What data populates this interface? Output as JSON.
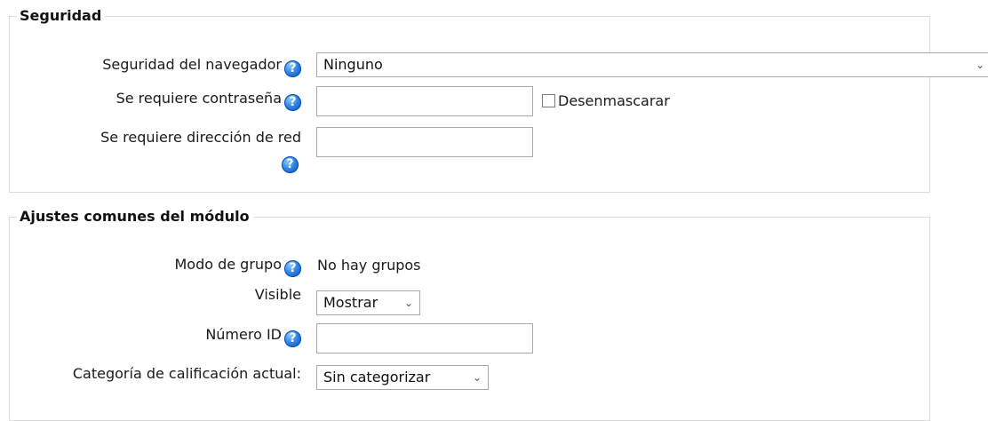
{
  "security": {
    "legend": "Seguridad",
    "browser_security": {
      "label": "Seguridad del navegador",
      "value": "Ninguno"
    },
    "password": {
      "label": "Se requiere contraseña",
      "value": "",
      "unmask_label": "Desenmascarar"
    },
    "network_address": {
      "label": "Se requiere dirección de red",
      "value": ""
    }
  },
  "common": {
    "legend": "Ajustes comunes del módulo",
    "group_mode": {
      "label": "Modo de grupo",
      "value": "No hay grupos"
    },
    "visible": {
      "label": "Visible",
      "value": "Mostrar"
    },
    "id_number": {
      "label": "Número ID",
      "value": ""
    },
    "grade_category": {
      "label": "Categoría de calificación actual:",
      "value": "Sin categorizar"
    }
  },
  "icons": {
    "help": "help-icon",
    "dropdown": "chevron-down-icon",
    "help_glyph": "?",
    "chevron_glyph": "⌄"
  }
}
